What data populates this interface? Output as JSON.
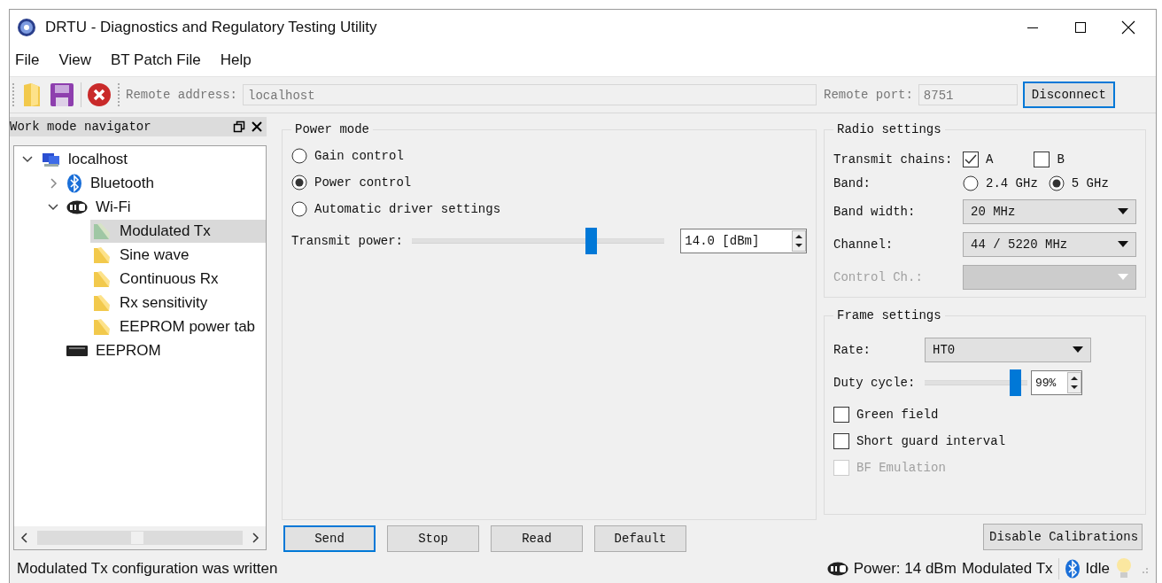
{
  "window": {
    "title": "DRTU - Diagnostics and Regulatory Testing Utility"
  },
  "menu": [
    "File",
    "View",
    "BT Patch File",
    "Help"
  ],
  "toolbar": {
    "remote_address_label": "Remote address:",
    "remote_address": "localhost",
    "remote_port_label": "Remote port:",
    "remote_port": "8751",
    "disconnect": {
      "label": "Disconnect",
      "focused": true
    }
  },
  "navigator": {
    "title": "Work mode navigator",
    "tree": [
      {
        "label": "localhost",
        "kind": "computer",
        "selected": false,
        "expanded": true,
        "children": [
          {
            "label": "Bluetooth",
            "kind": "bluetooth",
            "selected": false,
            "expanded": false
          },
          {
            "label": "Wi-Fi",
            "kind": "wifi",
            "selected": false,
            "expanded": true,
            "children": [
              {
                "label": "Modulated Tx",
                "kind": "mode",
                "selected": true
              },
              {
                "label": "Sine wave",
                "kind": "mode",
                "selected": false
              },
              {
                "label": "Continuous Rx",
                "kind": "mode",
                "selected": false
              },
              {
                "label": "Rx sensitivity",
                "kind": "mode",
                "selected": false
              },
              {
                "label": "EEPROM power tab",
                "kind": "mode",
                "selected": false
              }
            ]
          },
          {
            "label": "EEPROM",
            "kind": "chip",
            "selected": false
          }
        ]
      }
    ]
  },
  "power_mode": {
    "title": "Power mode",
    "options": [
      {
        "label": "Gain control",
        "selected": false
      },
      {
        "label": "Power control",
        "selected": true
      },
      {
        "label": "Automatic driver settings",
        "selected": false
      }
    ],
    "transmit_power": {
      "label": "Transmit power:",
      "level": 0.72,
      "value": "14.0 [dBm]"
    }
  },
  "radio_settings": {
    "title": "Radio settings",
    "transmit_chains": {
      "label": "Transmit chains:",
      "chains": [
        {
          "label": "A",
          "checked": true
        },
        {
          "label": "B",
          "checked": false
        }
      ]
    },
    "band": {
      "label": "Band:",
      "options": [
        {
          "label": "2.4 GHz",
          "selected": false
        },
        {
          "label": "5 GHz",
          "selected": true
        }
      ]
    },
    "band_width": {
      "label": "Band width:",
      "value": "20 MHz",
      "disabled": false
    },
    "channel": {
      "label": "Channel:",
      "value": "44 / 5220 MHz",
      "disabled": false
    },
    "control_ch": {
      "label": "Control Ch.:",
      "disabled": true
    }
  },
  "frame_settings": {
    "title": "Frame settings",
    "rate": {
      "label": "Rate:",
      "value": "HT0"
    },
    "duty_cycle": {
      "label": "Duty cycle:",
      "level": 0.93,
      "value": "99%"
    },
    "options": [
      {
        "label": "Green field",
        "checked": false,
        "disabled": false
      },
      {
        "label": "Short guard interval",
        "checked": false,
        "disabled": false
      },
      {
        "label": "BF Emulation",
        "checked": false,
        "disabled": true
      }
    ]
  },
  "buttons": [
    {
      "label": "Send",
      "focused": true
    },
    {
      "label": "Stop",
      "focused": false
    },
    {
      "label": "Read",
      "focused": false
    },
    {
      "label": "Default",
      "focused": false
    }
  ],
  "disable_calibrations": {
    "label": "Disable Calibrations",
    "focused": false
  },
  "status_bar": {
    "message": "Modulated Tx configuration was written",
    "power": "Power: 14 dBm",
    "mode": "Modulated Tx",
    "bluetooth_state": "Idle"
  }
}
